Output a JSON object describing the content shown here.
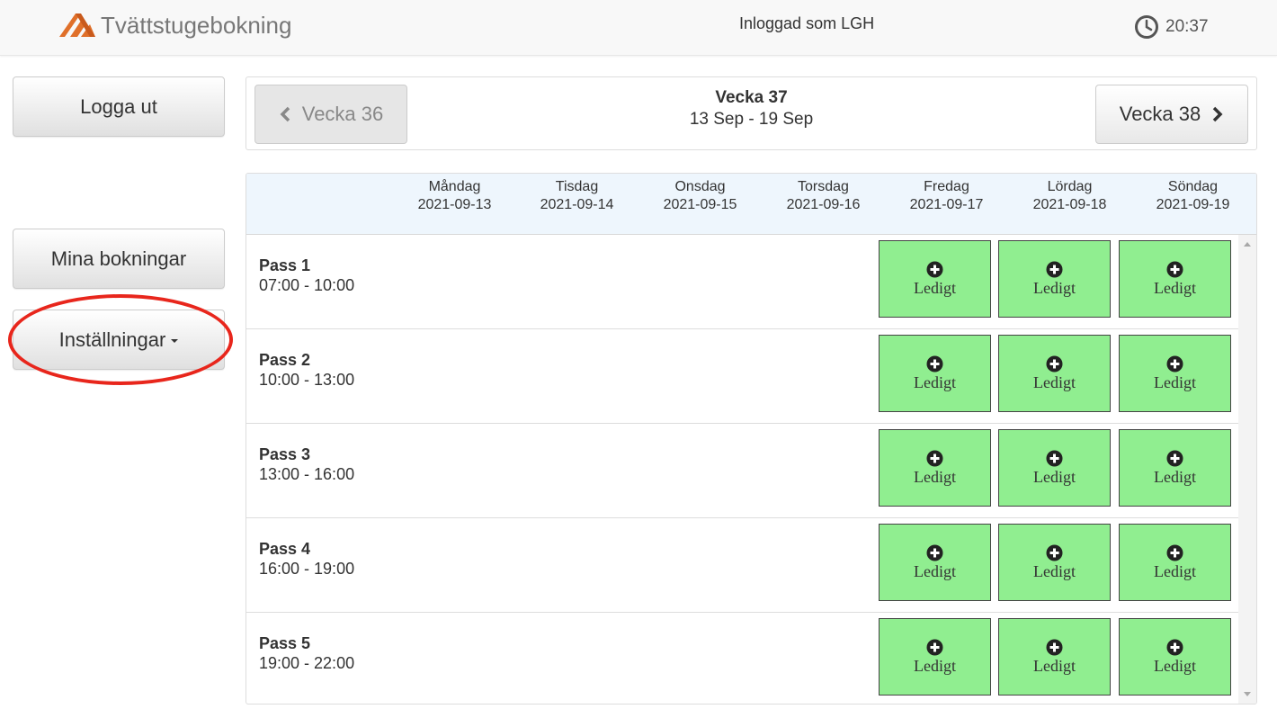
{
  "header": {
    "brand": "Tvättstugebokning",
    "logged_in": "Inloggad som LGH",
    "time": "20:37"
  },
  "sidebar": {
    "logout_label": "Logga ut",
    "my_bookings_label": "Mina bokningar",
    "settings_label": "Inställningar"
  },
  "week_nav": {
    "prev_label": "Vecka 36",
    "title": "Vecka 37",
    "range": "13 Sep - 19 Sep",
    "next_label": "Vecka 38"
  },
  "days": [
    {
      "name": "Måndag",
      "date": "2021-09-13"
    },
    {
      "name": "Tisdag",
      "date": "2021-09-14"
    },
    {
      "name": "Onsdag",
      "date": "2021-09-15"
    },
    {
      "name": "Torsdag",
      "date": "2021-09-16"
    },
    {
      "name": "Fredag",
      "date": "2021-09-17"
    },
    {
      "name": "Lördag",
      "date": "2021-09-18"
    },
    {
      "name": "Söndag",
      "date": "2021-09-19"
    }
  ],
  "passes": [
    {
      "name": "Pass 1",
      "time": "07:00 - 10:00",
      "slots": [
        "Ledigt",
        "Ledigt",
        "Ledigt"
      ]
    },
    {
      "name": "Pass 2",
      "time": "10:00 - 13:00",
      "slots": [
        "Ledigt",
        "Ledigt",
        "Ledigt"
      ]
    },
    {
      "name": "Pass 3",
      "time": "13:00 - 16:00",
      "slots": [
        "Ledigt",
        "Ledigt",
        "Ledigt"
      ]
    },
    {
      "name": "Pass 4",
      "time": "16:00 - 19:00",
      "slots": [
        "Ledigt",
        "Ledigt",
        "Ledigt"
      ]
    },
    {
      "name": "Pass 5",
      "time": "19:00 - 22:00",
      "slots": [
        "Ledigt",
        "Ledigt",
        "Ledigt"
      ]
    }
  ],
  "icons": {
    "brand": "brand-logo-icon",
    "clock": "clock-icon",
    "prev": "chevron-left-icon",
    "next": "chevron-right-icon",
    "slot": "plus-circle-icon",
    "dropdown": "caret-down-icon"
  },
  "colors": {
    "slot_available": "#90ee90",
    "header_bg": "#eef6fd",
    "highlight": "#e8261c",
    "brand_orange": "#e0702a"
  }
}
